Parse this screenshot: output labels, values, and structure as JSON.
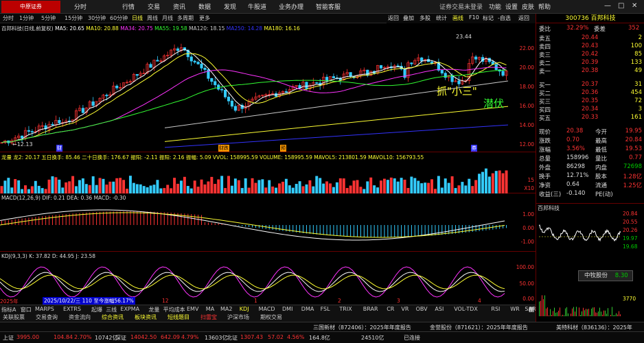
{
  "menubar": {
    "logo": "中原证券",
    "items": [
      "分时",
      "行情",
      "交易",
      "资讯",
      "数据",
      "发现",
      "牛股道",
      "业务办理",
      "智能客服"
    ],
    "right_notice": "证券交易未登录",
    "right_items": [
      "功能",
      "设置",
      "皮肤",
      "帮助"
    ]
  },
  "toolbar": {
    "items": [
      "分时",
      "1分钟",
      "5分钟",
      "15分钟",
      "30分钟",
      "60分钟",
      "日线",
      "周线",
      "月线",
      "多周期",
      "更多"
    ],
    "active": "日线"
  },
  "right_buttons": [
    "返回",
    "叠加",
    "多股",
    "统计",
    "画线",
    "F10",
    "标记",
    "-自选",
    "返回"
  ],
  "main_chart": {
    "title": "百邦科技(日线,前复权)",
    "ma": [
      {
        "label": "MA5: 20.65",
        "color": "#ffffff"
      },
      {
        "label": "MA10: 20.88",
        "color": "#ffff33"
      },
      {
        "label": "MA34: 20.75",
        "color": "#ff33ff"
      },
      {
        "label": "MA55: 19.58",
        "color": "#33ff33"
      },
      {
        "label": "MA120: 18.15",
        "color": "#cccccc"
      },
      {
        "label": "MA250: 14.28",
        "color": "#3333ff"
      },
      {
        "label": "MA180: 16.16",
        "color": "#ffff33"
      }
    ],
    "yticks": [
      "22.00",
      "20.00",
      "18.00",
      "16.00",
      "14.00",
      "12.00"
    ],
    "high_label": "23.44",
    "low_label": "←12.13",
    "annotation1": "抓\"小三\"",
    "annotation2": "潜伏",
    "markers": [
      "财",
      "预",
      "财",
      "预"
    ]
  },
  "vol_panel": {
    "info": "龙量 龙2: 20.17 五日换手: 85.46 二十日换手: 176.67 振阳: -2.11 振阳: 2.16 振幅: 5.09 VVOL: 158995.59 VOLUME: 158995.59 MAVOL5: 213801.59 MAVOL10: 156793.55",
    "yticks": [
      "15",
      "X10"
    ]
  },
  "macd_panel": {
    "info": "MACD(12,26,9) DIF: 0.21 DEA: 0.36 MACD: -0.30",
    "yticks": [
      "1.00",
      "0.00",
      "-1.00"
    ]
  },
  "kdj_panel": {
    "info": "KDJ(9,3,3) K: 37.82 D: 44.95 J: 23.58",
    "yticks": [
      "100.00",
      "50.00",
      "0.00"
    ],
    "date_tip": "2025/10/22/三 110 至今涨幅56.17%"
  },
  "x_axis": [
    "2025年",
    "12",
    "1",
    "2",
    "3",
    "4"
  ],
  "bottom_tabs": [
    "指标A",
    "窗口",
    "MARPS",
    "EXTRS",
    "起爆",
    "三线",
    "EXPMA",
    "龙量",
    "平均成本",
    "EMV",
    "MA",
    "MA2",
    "KDJ",
    "MACD",
    "DMI",
    "DMA",
    "FSL",
    "TRIX",
    "BRAR",
    "CR",
    "VR",
    "OBV",
    "ASI",
    "VOL-TDX",
    "RSI",
    "WR",
    "SAR",
    "指标B",
    "图文F10",
    "侧边栏5"
  ],
  "bottom_tabs2": [
    "关联股票",
    "交易查询",
    "资金流向",
    "综合资讯",
    "板块资讯",
    "短线题目",
    "扫雷宝",
    "沪深市场",
    "期权交易"
  ],
  "status1": {
    "items": [
      "三国新材（872406）：2025年年度报告",
      "金誉股份（871621）：2025年年度报告",
      "美特科材（836136）：2025年"
    ]
  },
  "status2": {
    "sh": "上证",
    "sh_val": "3995.00",
    "sh_chg": "104.84",
    "sh_pct": "2.70%",
    "sh_amt": "10742亿",
    "sz": "深证",
    "sz_val": "14042.50",
    "sz_chg": "642.09",
    "sz_pct": "4.79%",
    "sz_amt": "13603亿",
    "bz": "北证",
    "bz_val": "1307.43",
    "bz_chg": "57.02",
    "bz_pct": "4.56%",
    "bz_amt": "164.8亿",
    "net": "24510亿",
    "conn": "已连接"
  },
  "rpanel": {
    "code": "300736 百邦科技",
    "weibi_label": "委比",
    "weibi": "32.29%",
    "weicha_label": "委差",
    "weicha": "352",
    "asks": [
      {
        "l": "卖五",
        "p": "20.44",
        "v": "2"
      },
      {
        "l": "卖四",
        "p": "20.43",
        "v": "100"
      },
      {
        "l": "卖三",
        "p": "20.42",
        "v": "85"
      },
      {
        "l": "卖二",
        "p": "20.39",
        "v": "133"
      },
      {
        "l": "卖一",
        "p": "20.38",
        "v": "49"
      }
    ],
    "bids": [
      {
        "l": "买一",
        "p": "20.37",
        "v": "31"
      },
      {
        "l": "买二",
        "p": "20.36",
        "v": "454"
      },
      {
        "l": "买三",
        "p": "20.35",
        "v": "72"
      },
      {
        "l": "买四",
        "p": "20.34",
        "v": "3"
      },
      {
        "l": "买五",
        "p": "20.33",
        "v": "161"
      }
    ],
    "stats": [
      [
        "现价",
        "20.38",
        "今开",
        "19.95"
      ],
      [
        "涨跌",
        "0.70",
        "最高",
        "20.84"
      ],
      [
        "涨幅",
        "3.56%",
        "最低",
        "19.53"
      ],
      [
        "总量",
        "158996",
        "量比",
        "0.77"
      ],
      [
        "外盘",
        "86298",
        "内盘",
        "72698"
      ],
      [
        "换手",
        "12.71%",
        "股本",
        "1.28亿"
      ],
      [
        "净资",
        "0.64",
        "流通",
        "1.25亿"
      ],
      [
        "收益(三)",
        "-0.140",
        "PE(动)",
        ""
      ]
    ],
    "mini_title": "百邦科技",
    "mini_y": [
      "20.84",
      "20.55",
      "20.26",
      "19.97",
      "19.68",
      "3770"
    ],
    "zhongmu": "中牧股份",
    "zhongmu_val": "8.30"
  }
}
